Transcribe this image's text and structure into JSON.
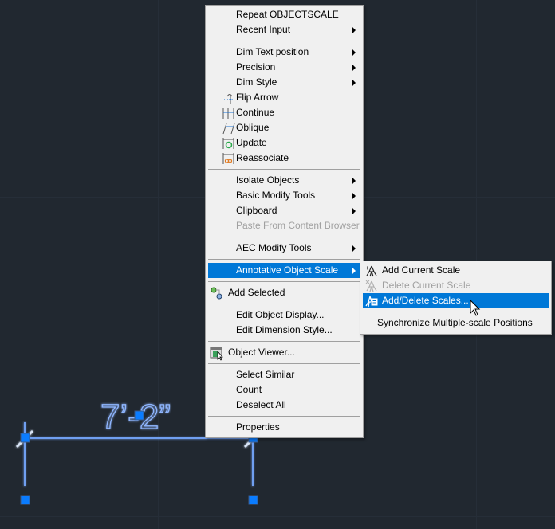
{
  "drawing": {
    "dimension_text": "7’-2”",
    "colors": {
      "background": "#212830",
      "dimension_line": "#5b8fe8",
      "grip": "#0a7cff"
    }
  },
  "context_menu": {
    "items": [
      {
        "label": "Repeat OBJECTSCALE"
      },
      {
        "label": "Recent Input",
        "submenu": true
      },
      {
        "label": "Dim Text position",
        "submenu": true
      },
      {
        "label": "Precision",
        "submenu": true
      },
      {
        "label": "Dim Style",
        "submenu": true
      },
      {
        "label": "Flip Arrow",
        "icon": "flip-arrow-icon"
      },
      {
        "label": "Continue",
        "icon": "continue-dimension-icon"
      },
      {
        "label": "Oblique",
        "icon": "oblique-dimension-icon"
      },
      {
        "label": "Update",
        "icon": "update-dimension-icon"
      },
      {
        "label": "Reassociate",
        "icon": "reassociate-icon"
      },
      {
        "label": "Isolate Objects",
        "submenu": true
      },
      {
        "label": "Basic Modify Tools",
        "submenu": true
      },
      {
        "label": "Clipboard",
        "submenu": true
      },
      {
        "label": "Paste From Content Browser",
        "disabled": true
      },
      {
        "label": "AEC Modify Tools",
        "submenu": true
      },
      {
        "label": "Annotative Object Scale",
        "submenu": true,
        "highlighted": true
      },
      {
        "label": "Add Selected",
        "icon": "add-selected-icon"
      },
      {
        "label": "Edit Object Display..."
      },
      {
        "label": "Edit Dimension Style..."
      },
      {
        "label": "Object Viewer...",
        "icon": "object-viewer-icon"
      },
      {
        "label": "Select Similar"
      },
      {
        "label": "Count"
      },
      {
        "label": "Deselect All"
      },
      {
        "label": "Properties"
      }
    ]
  },
  "scale_submenu": {
    "items": [
      {
        "label": "Add Current Scale",
        "icon": "add-scale-icon"
      },
      {
        "label": "Delete Current Scale",
        "icon": "delete-scale-icon",
        "disabled": true
      },
      {
        "label": "Add/Delete Scales...",
        "icon": "add-delete-scales-icon",
        "highlighted": true
      },
      {
        "label": "Synchronize Multiple-scale Positions"
      }
    ]
  },
  "colors": {
    "menu_bg": "#f0f0f0",
    "highlight": "#0078d7",
    "disabled_text": "#a0a0a0"
  }
}
